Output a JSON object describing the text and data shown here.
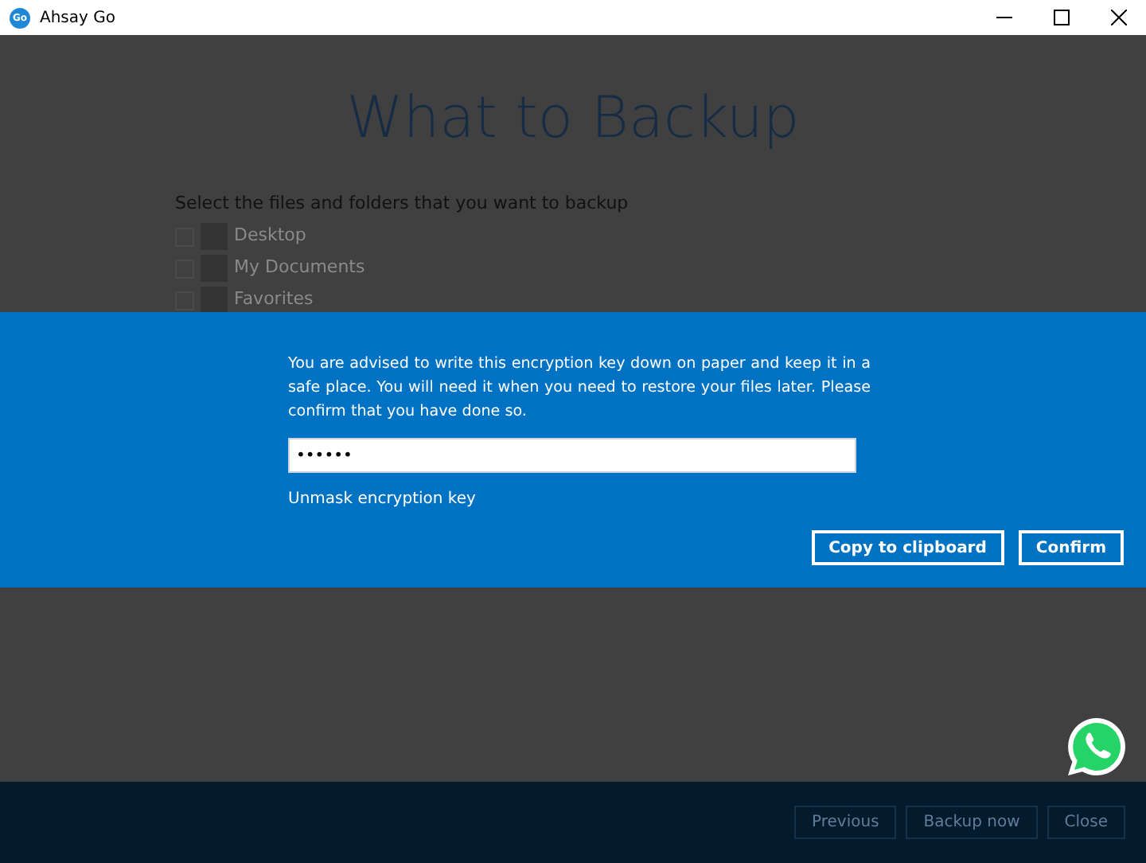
{
  "window": {
    "title": "Ahsay Go",
    "logo": "Go"
  },
  "page": {
    "title": "What to Backup",
    "instruction": "Select the files and folders that you want to backup",
    "items": [
      {
        "label": "Desktop",
        "checked": false
      },
      {
        "label": "My Documents",
        "checked": false
      },
      {
        "label": "Favorites",
        "checked": false
      }
    ]
  },
  "dialog": {
    "message": "You are advised to write this encryption key down on paper and keep it in a safe place. You will need it when you need to restore your files later. Please confirm that you have done so.",
    "key_value": "••••••",
    "unmask_link": "Unmask encryption key",
    "buttons": [
      "Copy to clipboard",
      "Confirm"
    ]
  },
  "footer": {
    "buttons": [
      {
        "label": "Previous",
        "disabled": true
      },
      {
        "label": "Backup now",
        "disabled": true
      },
      {
        "label": "Close",
        "disabled": true
      }
    ]
  }
}
